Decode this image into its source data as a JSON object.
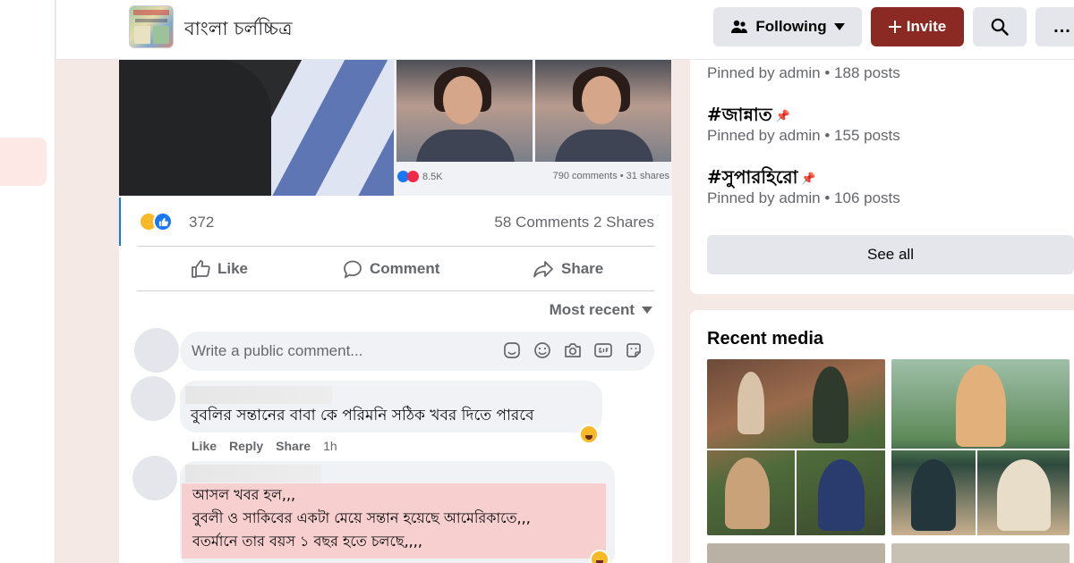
{
  "header": {
    "group_name": "বাংলা চর্লচ্চিত্র",
    "following_label": "Following",
    "invite_label": "Invite",
    "more_label": "..."
  },
  "post": {
    "mini_reaction_count": "8.5K",
    "mini_comments_shares": "790 comments • 31 shares",
    "reaction_count": "372",
    "comments_shares": "58 Comments  2 Shares",
    "actions": {
      "like": "Like",
      "comment": "Comment",
      "share": "Share"
    },
    "sort_label": "Most recent",
    "write_placeholder": "Write a public comment..."
  },
  "comments": [
    {
      "text": "বুবলির সন্তানের বাবা কে পরিমনি সঠিক খবর দিতে পারবে",
      "actions": {
        "like": "Like",
        "reply": "Reply",
        "share": "Share",
        "time": "1h"
      }
    },
    {
      "lines": [
        "আসল খবর হল,,,",
        "বুবলী ও সাকিবের একটা মেয়ে সন্তান হয়েছে আমেরিকাতে,,,",
        "বতর্মানে তার বয়স ১ বছর হতে চলছে,,,,"
      ]
    }
  ],
  "sidebar": {
    "pinned": [
      {
        "tag": "",
        "meta": "Pinned by admin • 188 posts"
      },
      {
        "tag": "#জান্নাত",
        "meta": "Pinned by admin • 155 posts"
      },
      {
        "tag": "#সুপারহিরো",
        "meta": "Pinned by admin • 106 posts"
      }
    ],
    "see_all_label": "See all",
    "recent_media_title": "Recent media"
  },
  "colors": {
    "accent_blue": "#1877f2",
    "invite_red": "#8b2a22",
    "highlight_pink": "#f7cfcf",
    "page_background": "#f5e9e6"
  },
  "icons": {
    "following": "people-icon",
    "following_caret": "caret-down-icon",
    "invite": "plus-icon",
    "search": "search-icon",
    "like": "thumbs-up-icon",
    "comment": "speech-bubble-icon",
    "share": "share-arrow-icon",
    "write": [
      "sticker-icon",
      "emoji-icon",
      "camera-icon",
      "gif-icon",
      "avatar-sticker-icon"
    ],
    "pin": "pin-icon"
  }
}
